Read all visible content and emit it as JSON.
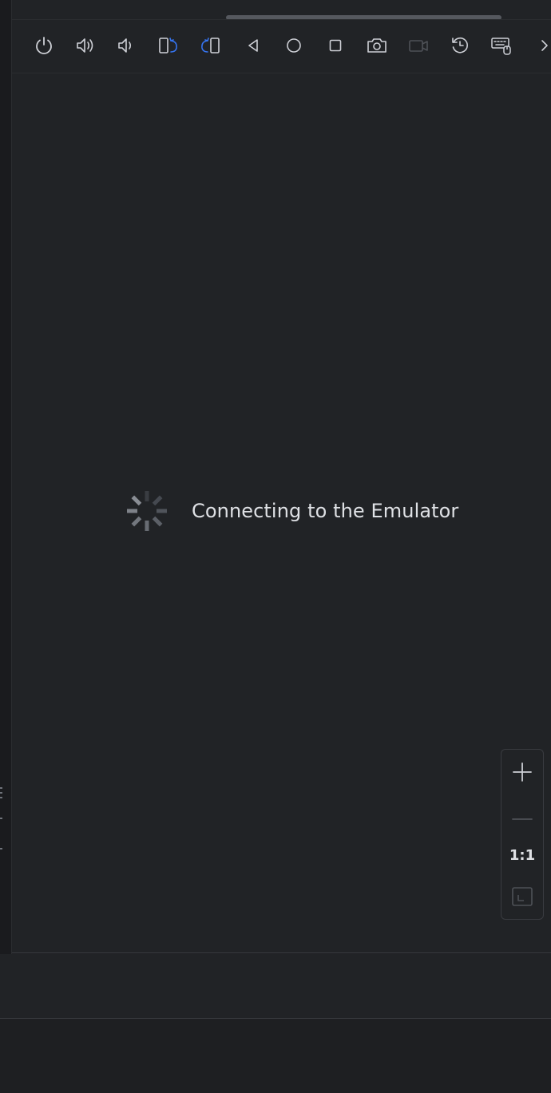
{
  "toolbar": {
    "buttons": [
      {
        "name": "power-button",
        "icon": "power-icon"
      },
      {
        "name": "volume-up-button",
        "icon": "volume-up-icon"
      },
      {
        "name": "volume-down-button",
        "icon": "volume-down-icon"
      },
      {
        "name": "rotate-left-button",
        "icon": "rotate-left-icon"
      },
      {
        "name": "rotate-right-button",
        "icon": "rotate-right-icon"
      },
      {
        "name": "back-button",
        "icon": "back-triangle-icon"
      },
      {
        "name": "home-button",
        "icon": "home-circle-icon"
      },
      {
        "name": "overview-button",
        "icon": "overview-square-icon"
      },
      {
        "name": "screenshot-button",
        "icon": "camera-icon"
      },
      {
        "name": "record-screen-button",
        "icon": "video-camera-icon"
      },
      {
        "name": "snapshot-button",
        "icon": "snapshot-restore-icon"
      },
      {
        "name": "keyboard-input-button",
        "icon": "keyboard-mouse-icon"
      },
      {
        "name": "more-button",
        "icon": "chevron-right-icon"
      }
    ]
  },
  "status": {
    "message": "Connecting to the Emulator"
  },
  "zoom": {
    "zoom_in_icon": "plus-icon",
    "zoom_out_icon": "minus-icon",
    "actual_size_label": "1:1",
    "fit_icon": "fit-screen-icon"
  },
  "colors": {
    "background": "#212326",
    "icon": "#ced0d6",
    "accent": "#3574f0",
    "disabled": "#4e5157",
    "text": "#dfe1e5"
  }
}
